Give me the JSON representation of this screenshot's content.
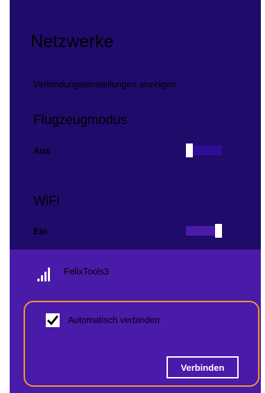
{
  "panel": {
    "title": "Netzwerke",
    "settings_link": "Verbindungseinstellungen anzeigen",
    "colors": {
      "top_bg": "#1f0b6a",
      "bottom_bg": "#4a1aa9",
      "highlight": "#f29a2e"
    }
  },
  "airplane_mode": {
    "heading": "Flugzeugmodus",
    "state": "Aus",
    "enabled": false
  },
  "wifi": {
    "heading": "WiFi",
    "state": "Ein",
    "enabled": true
  },
  "network": {
    "name": "FelixTools3",
    "signal_icon": "wifi-signal-icon",
    "signal_bars": 4,
    "auto_connect_label": "Automatisch verbinden",
    "auto_connect_checked": true,
    "connect_label": "Verbinden"
  }
}
